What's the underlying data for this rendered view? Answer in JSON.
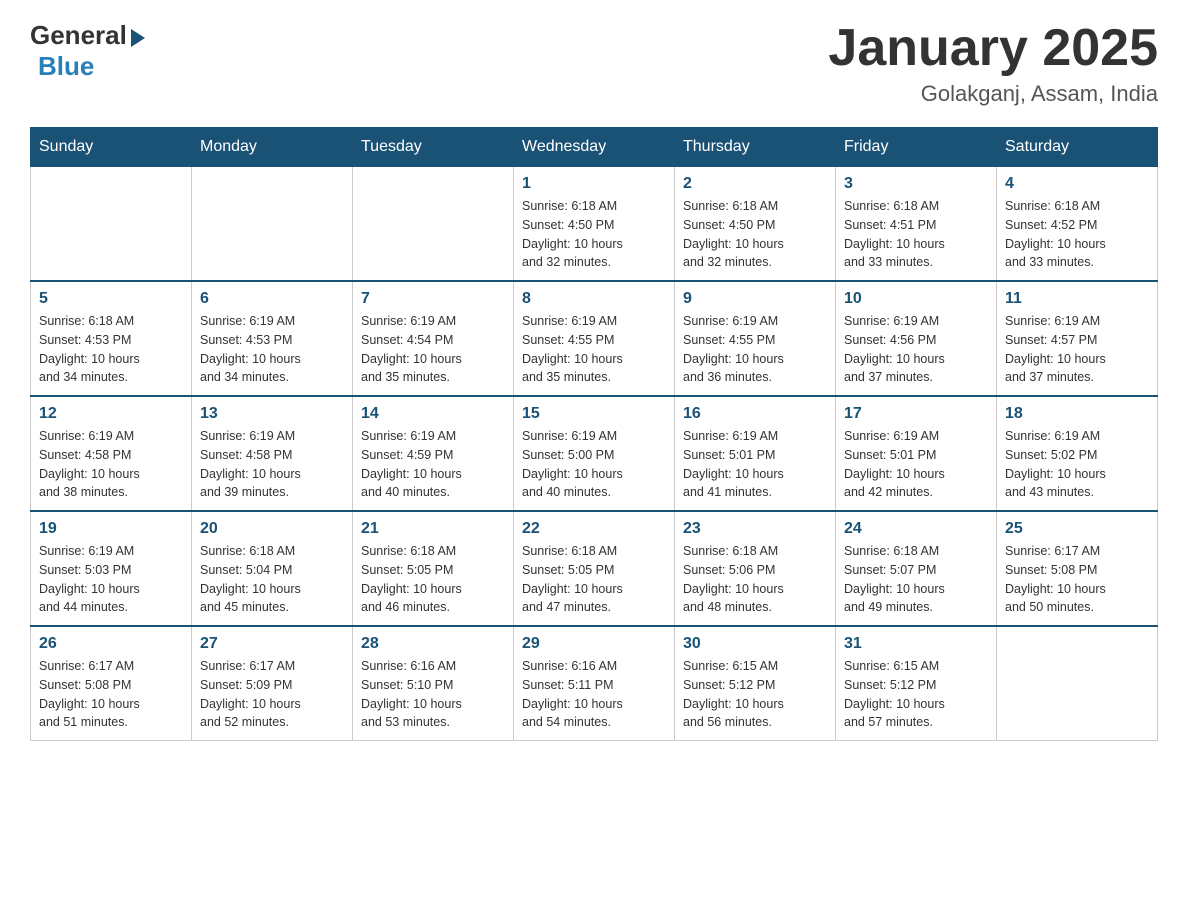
{
  "header": {
    "logo_general": "General",
    "logo_blue": "Blue",
    "month_year": "January 2025",
    "location": "Golakganj, Assam, India"
  },
  "weekdays": [
    "Sunday",
    "Monday",
    "Tuesday",
    "Wednesday",
    "Thursday",
    "Friday",
    "Saturday"
  ],
  "weeks": [
    [
      {
        "day": "",
        "info": ""
      },
      {
        "day": "",
        "info": ""
      },
      {
        "day": "",
        "info": ""
      },
      {
        "day": "1",
        "info": "Sunrise: 6:18 AM\nSunset: 4:50 PM\nDaylight: 10 hours\nand 32 minutes."
      },
      {
        "day": "2",
        "info": "Sunrise: 6:18 AM\nSunset: 4:50 PM\nDaylight: 10 hours\nand 32 minutes."
      },
      {
        "day": "3",
        "info": "Sunrise: 6:18 AM\nSunset: 4:51 PM\nDaylight: 10 hours\nand 33 minutes."
      },
      {
        "day": "4",
        "info": "Sunrise: 6:18 AM\nSunset: 4:52 PM\nDaylight: 10 hours\nand 33 minutes."
      }
    ],
    [
      {
        "day": "5",
        "info": "Sunrise: 6:18 AM\nSunset: 4:53 PM\nDaylight: 10 hours\nand 34 minutes."
      },
      {
        "day": "6",
        "info": "Sunrise: 6:19 AM\nSunset: 4:53 PM\nDaylight: 10 hours\nand 34 minutes."
      },
      {
        "day": "7",
        "info": "Sunrise: 6:19 AM\nSunset: 4:54 PM\nDaylight: 10 hours\nand 35 minutes."
      },
      {
        "day": "8",
        "info": "Sunrise: 6:19 AM\nSunset: 4:55 PM\nDaylight: 10 hours\nand 35 minutes."
      },
      {
        "day": "9",
        "info": "Sunrise: 6:19 AM\nSunset: 4:55 PM\nDaylight: 10 hours\nand 36 minutes."
      },
      {
        "day": "10",
        "info": "Sunrise: 6:19 AM\nSunset: 4:56 PM\nDaylight: 10 hours\nand 37 minutes."
      },
      {
        "day": "11",
        "info": "Sunrise: 6:19 AM\nSunset: 4:57 PM\nDaylight: 10 hours\nand 37 minutes."
      }
    ],
    [
      {
        "day": "12",
        "info": "Sunrise: 6:19 AM\nSunset: 4:58 PM\nDaylight: 10 hours\nand 38 minutes."
      },
      {
        "day": "13",
        "info": "Sunrise: 6:19 AM\nSunset: 4:58 PM\nDaylight: 10 hours\nand 39 minutes."
      },
      {
        "day": "14",
        "info": "Sunrise: 6:19 AM\nSunset: 4:59 PM\nDaylight: 10 hours\nand 40 minutes."
      },
      {
        "day": "15",
        "info": "Sunrise: 6:19 AM\nSunset: 5:00 PM\nDaylight: 10 hours\nand 40 minutes."
      },
      {
        "day": "16",
        "info": "Sunrise: 6:19 AM\nSunset: 5:01 PM\nDaylight: 10 hours\nand 41 minutes."
      },
      {
        "day": "17",
        "info": "Sunrise: 6:19 AM\nSunset: 5:01 PM\nDaylight: 10 hours\nand 42 minutes."
      },
      {
        "day": "18",
        "info": "Sunrise: 6:19 AM\nSunset: 5:02 PM\nDaylight: 10 hours\nand 43 minutes."
      }
    ],
    [
      {
        "day": "19",
        "info": "Sunrise: 6:19 AM\nSunset: 5:03 PM\nDaylight: 10 hours\nand 44 minutes."
      },
      {
        "day": "20",
        "info": "Sunrise: 6:18 AM\nSunset: 5:04 PM\nDaylight: 10 hours\nand 45 minutes."
      },
      {
        "day": "21",
        "info": "Sunrise: 6:18 AM\nSunset: 5:05 PM\nDaylight: 10 hours\nand 46 minutes."
      },
      {
        "day": "22",
        "info": "Sunrise: 6:18 AM\nSunset: 5:05 PM\nDaylight: 10 hours\nand 47 minutes."
      },
      {
        "day": "23",
        "info": "Sunrise: 6:18 AM\nSunset: 5:06 PM\nDaylight: 10 hours\nand 48 minutes."
      },
      {
        "day": "24",
        "info": "Sunrise: 6:18 AM\nSunset: 5:07 PM\nDaylight: 10 hours\nand 49 minutes."
      },
      {
        "day": "25",
        "info": "Sunrise: 6:17 AM\nSunset: 5:08 PM\nDaylight: 10 hours\nand 50 minutes."
      }
    ],
    [
      {
        "day": "26",
        "info": "Sunrise: 6:17 AM\nSunset: 5:08 PM\nDaylight: 10 hours\nand 51 minutes."
      },
      {
        "day": "27",
        "info": "Sunrise: 6:17 AM\nSunset: 5:09 PM\nDaylight: 10 hours\nand 52 minutes."
      },
      {
        "day": "28",
        "info": "Sunrise: 6:16 AM\nSunset: 5:10 PM\nDaylight: 10 hours\nand 53 minutes."
      },
      {
        "day": "29",
        "info": "Sunrise: 6:16 AM\nSunset: 5:11 PM\nDaylight: 10 hours\nand 54 minutes."
      },
      {
        "day": "30",
        "info": "Sunrise: 6:15 AM\nSunset: 5:12 PM\nDaylight: 10 hours\nand 56 minutes."
      },
      {
        "day": "31",
        "info": "Sunrise: 6:15 AM\nSunset: 5:12 PM\nDaylight: 10 hours\nand 57 minutes."
      },
      {
        "day": "",
        "info": ""
      }
    ]
  ]
}
